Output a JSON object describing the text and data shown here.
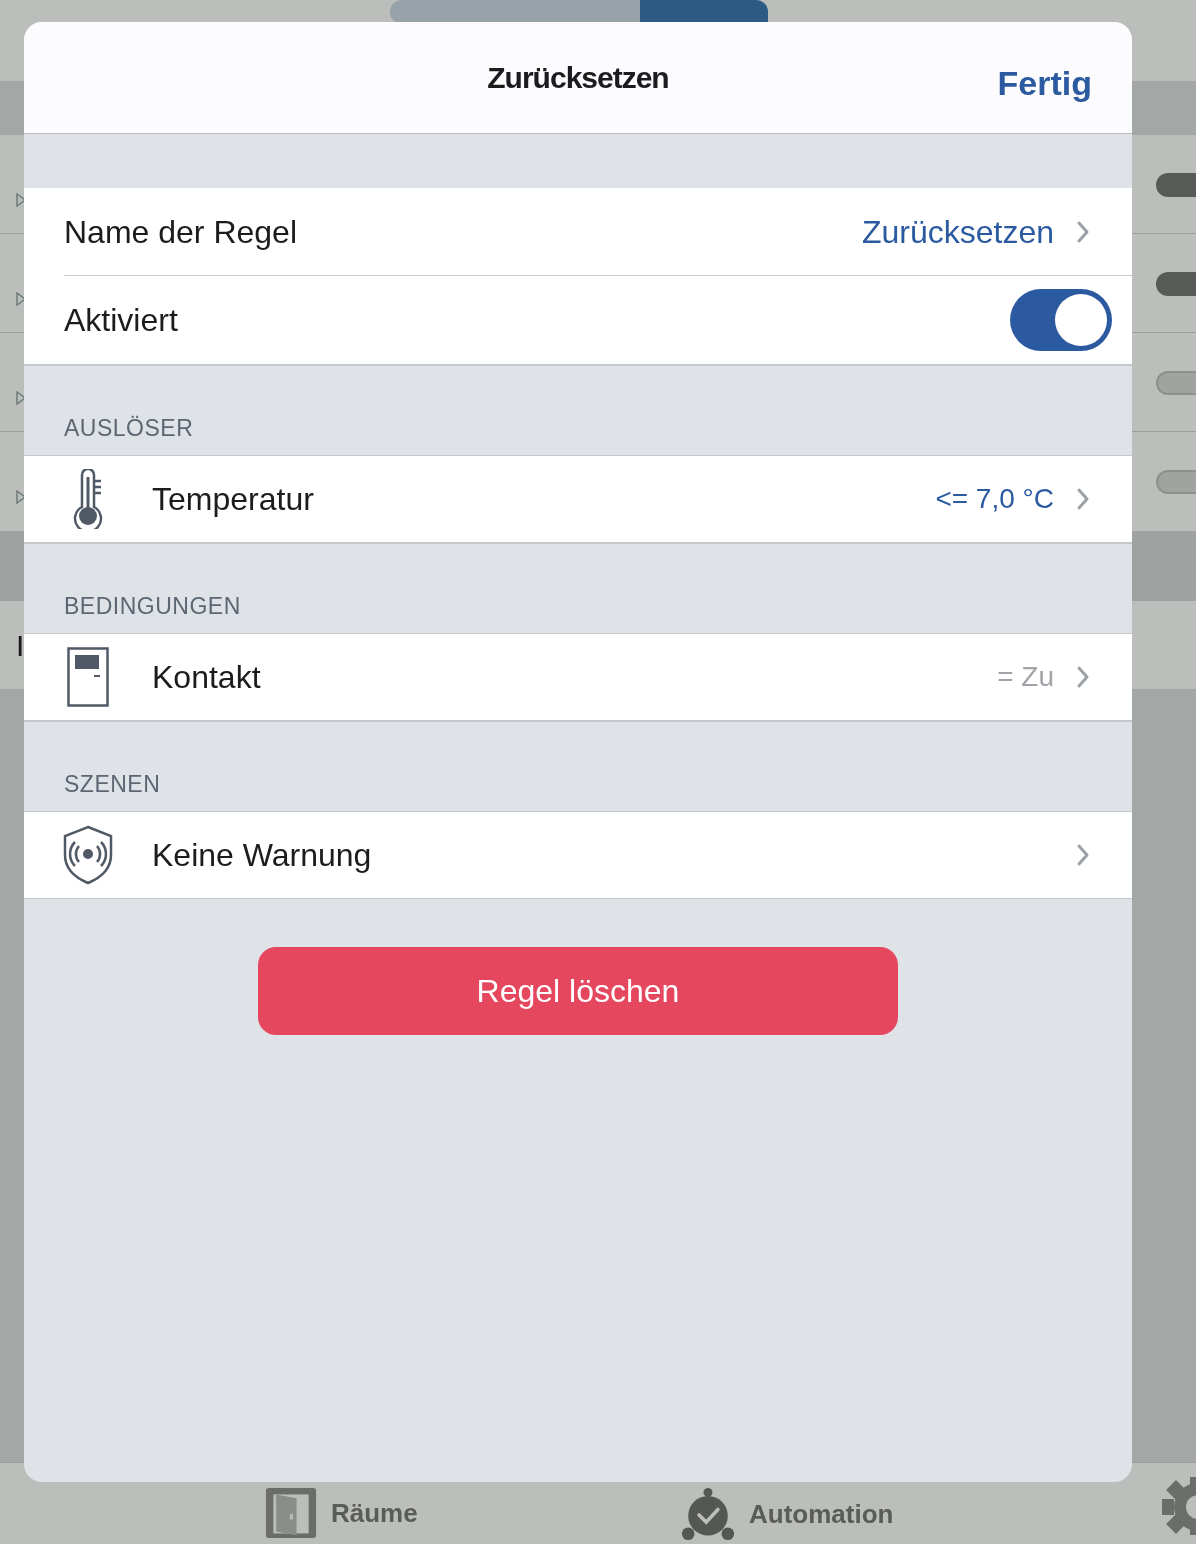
{
  "background": {
    "rows": [
      {
        "on": true
      },
      {
        "on": true
      },
      {
        "on": false
      },
      {
        "on": false
      }
    ],
    "lower_row": {
      "letter": "I"
    },
    "tab_bar": [
      {
        "kind": "door",
        "label": "Räume"
      },
      {
        "kind": "clock",
        "label": "Automation"
      },
      {
        "kind": "gear"
      }
    ]
  },
  "sheet": {
    "title": "Zurücksetzen",
    "done": "Fertig",
    "name_row": {
      "label": "Name der Regel",
      "value": "Zurücksetzen"
    },
    "enabled_row": {
      "label": "Aktiviert",
      "on": true
    },
    "sections": [
      {
        "header": "AUSLÖSER",
        "rows": [
          {
            "kind": "thermometer",
            "label": "Temperatur",
            "value": "<= 7,0 °C",
            "color": "#2b5aa0"
          }
        ]
      },
      {
        "header": "BEDINGUNGEN",
        "rows": [
          {
            "kind": "contact",
            "label": "Kontakt",
            "value": "= Zu",
            "color": "#a0a4a8"
          }
        ]
      },
      {
        "header": "SZENEN",
        "rows": [
          {
            "kind": "shield",
            "label": "Keine Warnung"
          }
        ]
      }
    ],
    "delete_button": "Regel löschen"
  }
}
